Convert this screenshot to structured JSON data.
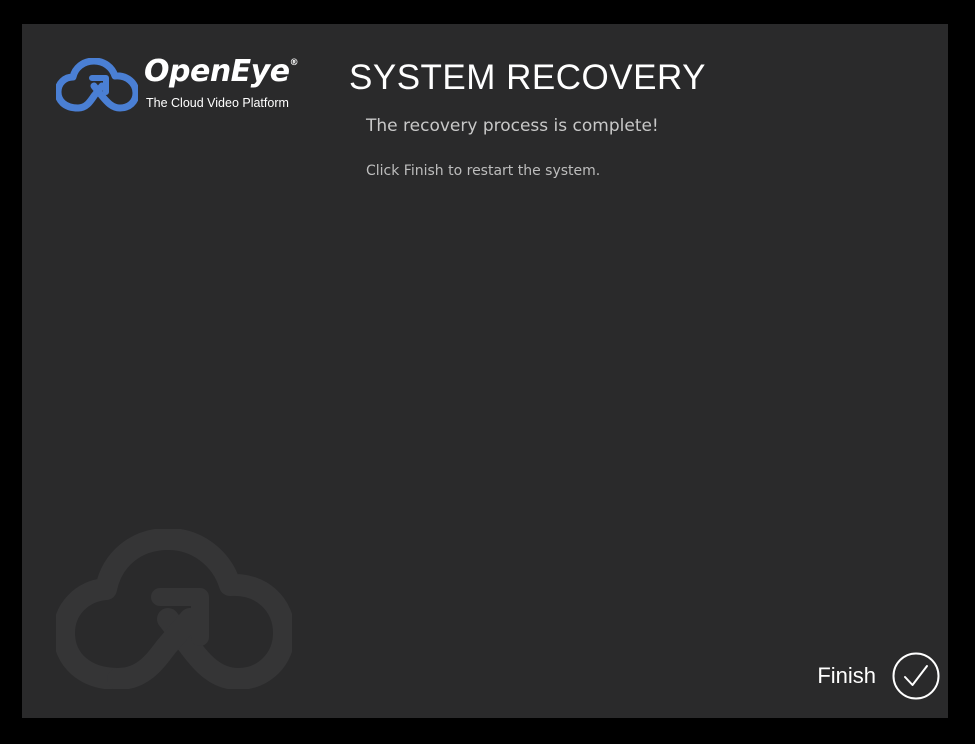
{
  "brand": {
    "name": "OpenEye",
    "registered_mark": "®",
    "tagline": "The Cloud Video Platform",
    "logo_color": "#4a7fd4"
  },
  "page": {
    "title": "SYSTEM RECOVERY",
    "message": "The recovery process is complete!",
    "instruction": "Click Finish to restart the system."
  },
  "actions": {
    "finish_label": "Finish",
    "finish_icon": "check-circle-icon"
  },
  "colors": {
    "background": "#000000",
    "panel": "#2a2a2b",
    "text_primary": "#ffffff",
    "text_secondary": "#c8c8c8"
  }
}
